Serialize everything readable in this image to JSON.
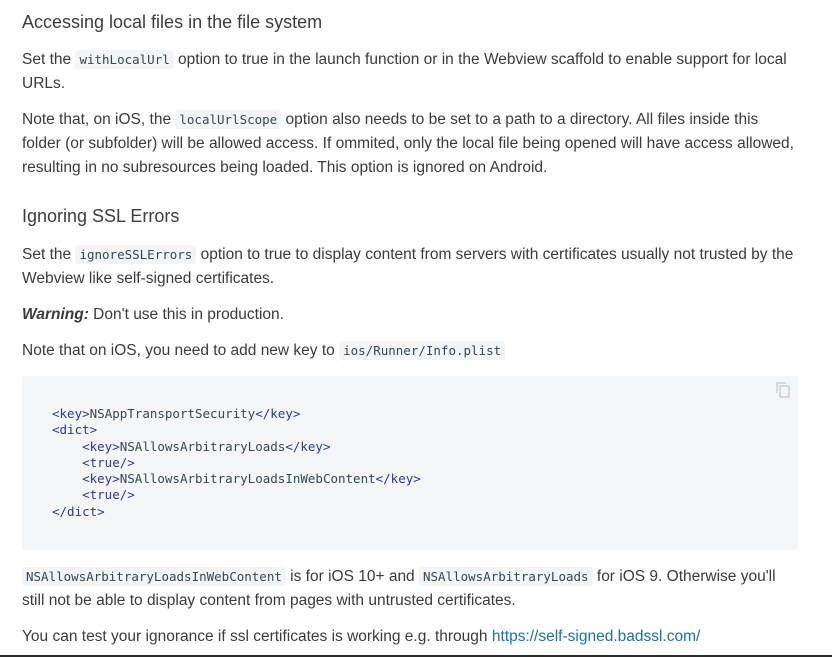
{
  "sections": {
    "local_files": {
      "heading": "Accessing local files in the file system",
      "p1_before": "Set the ",
      "p1_code": "withLocalUrl",
      "p1_after": " option to true in the launch function or in the Webview scaffold to enable support for local URLs.",
      "p2_before": "Note that, on iOS, the ",
      "p2_code": "localUrlScope",
      "p2_after": " option also needs to be set to a path to a directory. All files inside this folder (or subfolder) will be allowed access. If ommited, only the local file being opened will have access allowed, resulting in no subresources being loaded. This option is ignored on Android."
    },
    "ssl": {
      "heading": "Ignoring SSL Errors",
      "p1_before": "Set the ",
      "p1_code": "ignoreSSLErrors",
      "p1_after": " option to true to display content from servers with certificates usually not trusted by the Webview like self-signed certificates.",
      "warning_label": "Warning:",
      "warning_text": " Don't use this in production.",
      "note_before": "Note that on iOS, you need to add new key to ",
      "note_code": "ios/Runner/Info.plist",
      "code_lines": [
        {
          "indent": "",
          "open": "<key>",
          "text": "NSAppTransportSecurity",
          "close": "</key>"
        },
        {
          "indent": "",
          "open": "<dict>",
          "text": "",
          "close": ""
        },
        {
          "indent": "    ",
          "open": "<key>",
          "text": "NSAllowsArbitraryLoads",
          "close": "</key>"
        },
        {
          "indent": "    ",
          "open": "<true/>",
          "text": "",
          "close": ""
        },
        {
          "indent": "    ",
          "open": "<key>",
          "text": "NSAllowsArbitraryLoadsInWebContent",
          "close": "</key>"
        },
        {
          "indent": "    ",
          "open": "<true/>",
          "text": "",
          "close": ""
        },
        {
          "indent": "",
          "open": "</dict>",
          "text": "",
          "close": ""
        }
      ],
      "after_code1": "NSAllowsArbitraryLoadsInWebContent",
      "after_text1": " is for iOS 10+ and ",
      "after_code2": "NSAllowsArbitraryLoads",
      "after_text2": " for iOS 9. Otherwise you'll still not be able to display content from pages with untrusted certificates.",
      "last_before": "You can test your ignorance if ssl certificates is working e.g. through ",
      "last_link": "https://self-signed.badssl.com/"
    }
  },
  "icons": {
    "copy": "copy-icon"
  },
  "colors": {
    "link": "#1a6fb0",
    "code_bg": "#f4f5f6",
    "inline_code_bg": "#f3f4f6"
  }
}
